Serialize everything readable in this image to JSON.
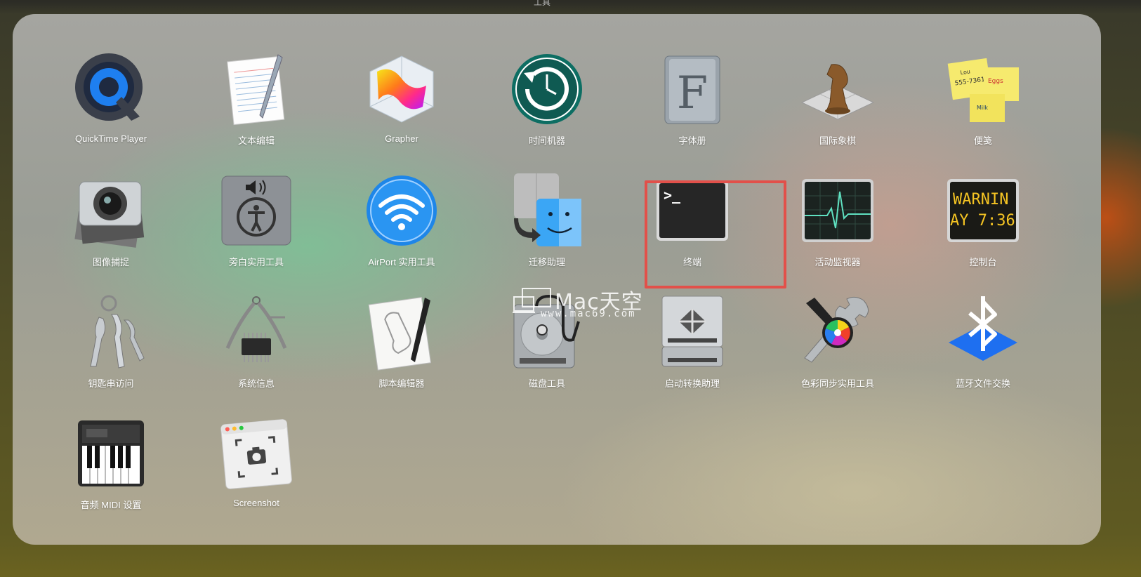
{
  "top_title": "工具",
  "apps": [
    {
      "label": "QuickTime Player",
      "icon": "quicktime-icon"
    },
    {
      "label": "文本编辑",
      "icon": "textedit-icon"
    },
    {
      "label": "Grapher",
      "icon": "grapher-icon"
    },
    {
      "label": "时间机器",
      "icon": "time-machine-icon"
    },
    {
      "label": "字体册",
      "icon": "font-book-icon"
    },
    {
      "label": "国际象棋",
      "icon": "chess-icon"
    },
    {
      "label": "便笺",
      "icon": "stickies-icon"
    },
    {
      "label": "图像捕捉",
      "icon": "image-capture-icon"
    },
    {
      "label": "旁白实用工具",
      "icon": "voiceover-utility-icon"
    },
    {
      "label": "AirPort 实用工具",
      "icon": "airport-utility-icon"
    },
    {
      "label": "迁移助理",
      "icon": "migration-assistant-icon"
    },
    {
      "label": "终端",
      "icon": "terminal-icon"
    },
    {
      "label": "活动监视器",
      "icon": "activity-monitor-icon"
    },
    {
      "label": "控制台",
      "icon": "console-icon"
    },
    {
      "label": "钥匙串访问",
      "icon": "keychain-access-icon"
    },
    {
      "label": "系统信息",
      "icon": "system-information-icon"
    },
    {
      "label": "脚本编辑器",
      "icon": "script-editor-icon"
    },
    {
      "label": "磁盘工具",
      "icon": "disk-utility-icon"
    },
    {
      "label": "启动转换助理",
      "icon": "boot-camp-assistant-icon"
    },
    {
      "label": "色彩同步实用工具",
      "icon": "colorsync-utility-icon"
    },
    {
      "label": "蓝牙文件交换",
      "icon": "bluetooth-file-exchange-icon"
    },
    {
      "label": "音频 MIDI 设置",
      "icon": "audio-midi-setup-icon"
    },
    {
      "label": "Screenshot",
      "icon": "screenshot-icon"
    }
  ],
  "icon_text": {
    "stickies_line1": "Lou",
    "stickies_line2": "555-7361",
    "stickies_eggs": "Eggs",
    "stickies_milk": "Milk",
    "console_line1": "WARNIN",
    "console_line2": "AY 7:36",
    "terminal_prompt": ">_",
    "font_book_letter": "F"
  },
  "watermark": {
    "title": "Mac天空",
    "subtitle": "www.mac69.com"
  },
  "colors": {
    "highlight": "#e2504a",
    "label": "#ffffff"
  },
  "selected_app": "终端"
}
